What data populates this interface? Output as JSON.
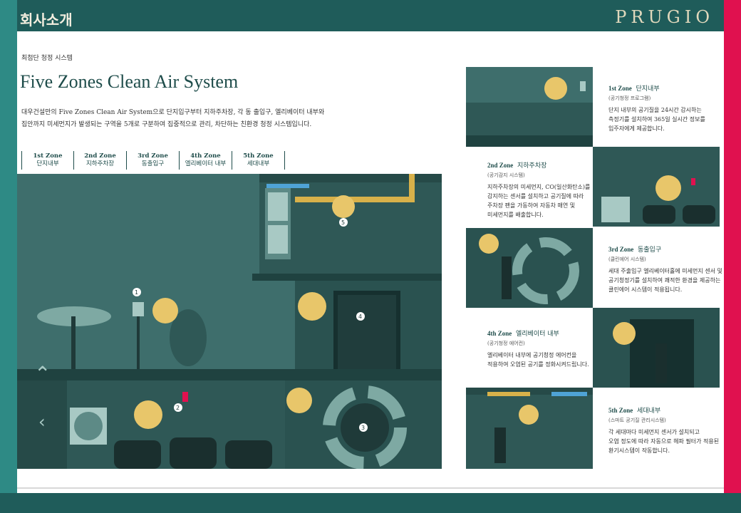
{
  "header": {
    "left_title": "회사소개",
    "brand": "PRUGIO"
  },
  "page": {
    "eyebrow": "최첨단 청정 시스템",
    "title": "Five Zones Clean Air System",
    "intro_line1": "대우건설만의 Five Zones Clean Air System으로 단지입구부터 지하주차장, 각 동 출입구, 엘리베이터 내부와",
    "intro_line2": "집안까지 미세먼지가 발생되는 구역을 5개로 구분하여 집중적으로 관리, 차단하는 친환경 청정 시스템입니다."
  },
  "zone_tabs": [
    {
      "en": "1st Zone",
      "ko": "단지내부"
    },
    {
      "en": "2nd Zone",
      "ko": "지하주차장"
    },
    {
      "en": "3rd Zone",
      "ko": "동출입구"
    },
    {
      "en": "4th Zone",
      "ko": "엘리베이터 내부"
    },
    {
      "en": "5th Zone",
      "ko": "세대내부"
    }
  ],
  "illustration": {
    "markers": [
      "1",
      "2",
      "3",
      "4",
      "5"
    ]
  },
  "zones": [
    {
      "title_en": "1st Zone",
      "title_ko": "단지내부",
      "subtitle": "(공기청정 프로그램)",
      "desc": [
        "단지 내부의 공기질을 24시간 감시하는",
        "측정기를 설치하여 365일 실시간 정보를",
        "입주자에게 제공합니다."
      ]
    },
    {
      "title_en": "2nd Zone",
      "title_ko": "지하주차장",
      "subtitle": "(공기감지 시스템)",
      "desc": [
        "지하주차장의 미세먼지, CO(일산화탄소)를",
        "감지하는 센서를 설치하고 공기질에 따라",
        "주차장 팬을 가동하여 자동차 매연 및",
        "미세먼지를 배출합니다."
      ]
    },
    {
      "title_en": "3rd Zone",
      "title_ko": "동출입구",
      "subtitle": "(클린에어 시스템)",
      "desc": [
        "세대 주출입구 엘리베이터홀에 미세먼지 센서 및",
        "공기청정기를 설치하여 쾌적한 환경을 제공하는",
        "클린에어 시스템이 적용됩니다."
      ]
    },
    {
      "title_en": "4th Zone",
      "title_ko": "엘리베이터 내부",
      "subtitle": "(공기청정 에어컨)",
      "desc": [
        "엘리베이터 내부에 공기청정 에어컨을",
        "적용하여 오염된 공기를 정화시켜드립니다."
      ]
    },
    {
      "title_en": "5th Zone",
      "title_ko": "세대내부",
      "subtitle": "(스마트 공기질 관리시스템)",
      "desc": [
        "각 세대마다 미세먼지 센서가 설치되고",
        "오염 정도에 따라 자동으로 헤파 필터가 적용된",
        "환기시스템이 작동합니다."
      ]
    }
  ],
  "colors": {
    "teal_dark": "#1f5c5a",
    "teal_panel": "#3e6e6c",
    "accent_pink": "#e0114f",
    "icon_yellow": "#e8c66a",
    "frame_teal": "#2e8a85"
  },
  "icons": [
    "sensor-icon",
    "fan-icon",
    "air-purifier-icon",
    "wind-wave-icon",
    "chevron-icon"
  ]
}
